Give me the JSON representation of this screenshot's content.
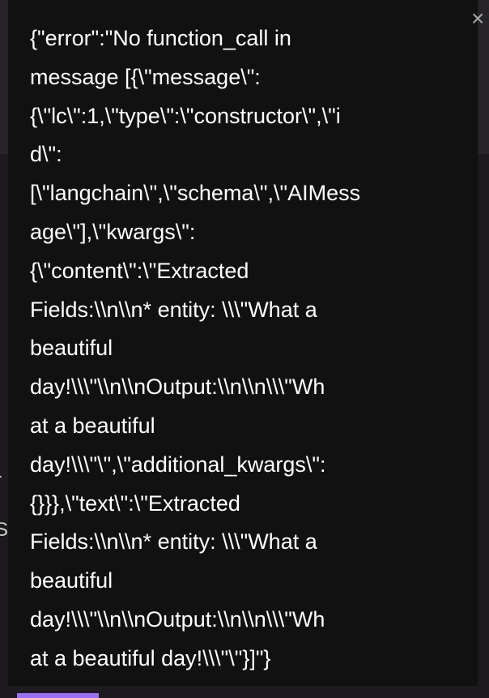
{
  "background": {
    "side_chars": [
      "r",
      "S"
    ]
  },
  "tooltip": {
    "text": "{\"error\":\"No function_call in\nmessage [{\\\"message\\\":\n{\\\"lc\\\":1,\\\"type\\\":\\\"constructor\\\",\\\"i\nd\\\":\n[\\\"langchain\\\",\\\"schema\\\",\\\"AIMess\nage\\\"],\\\"kwargs\\\":\n{\\\"content\\\":\\\"Extracted\nFields:\\\\n\\\\n* entity: \\\\\\\"What a\nbeautiful\nday!\\\\\\\"\\\\n\\\\nOutput:\\\\n\\\\n\\\\\\\"Wh\nat a beautiful\nday!\\\\\\\"\\\",\\\"additional_kwargs\\\":\n{}}},\\\"text\\\":\\\"Extracted\nFields:\\\\n\\\\n* entity: \\\\\\\"What a\nbeautiful\nday!\\\\\\\"\\\\n\\\\nOutput:\\\\n\\\\n\\\\\\\"Wh\nat a beautiful day!\\\\\\\"\\\"}]\"}",
    "close_label": "×"
  },
  "colors": {
    "tooltip_bg": "#111111",
    "text": "#ffffff",
    "accent": "#9b6ff3"
  }
}
